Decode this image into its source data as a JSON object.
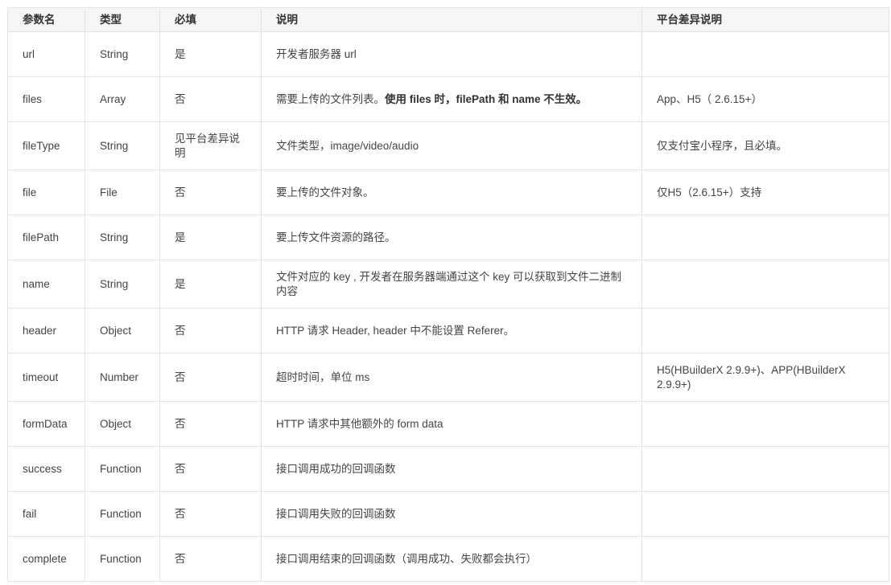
{
  "table": {
    "headers": [
      "参数名",
      "类型",
      "必填",
      "说明",
      "平台差异说明"
    ],
    "rows": [
      {
        "name": "url",
        "type": "String",
        "required": "是",
        "desc": "开发者服务器 url",
        "desc_bold": "",
        "platform": ""
      },
      {
        "name": "files",
        "type": "Array",
        "required": "否",
        "desc": "需要上传的文件列表。",
        "desc_bold": "使用 files 时，filePath 和 name 不生效。",
        "platform": "App、H5（ 2.6.15+）"
      },
      {
        "name": "fileType",
        "type": "String",
        "required": "见平台差异说明",
        "desc": "文件类型，image/video/audio",
        "desc_bold": "",
        "platform": "仅支付宝小程序，且必填。"
      },
      {
        "name": "file",
        "type": "File",
        "required": "否",
        "desc": "要上传的文件对象。",
        "desc_bold": "",
        "platform": "仅H5（2.6.15+）支持"
      },
      {
        "name": "filePath",
        "type": "String",
        "required": "是",
        "desc": "要上传文件资源的路径。",
        "desc_bold": "",
        "platform": ""
      },
      {
        "name": "name",
        "type": "String",
        "required": "是",
        "desc": "文件对应的 key , 开发者在服务器端通过这个 key 可以获取到文件二进制内容",
        "desc_bold": "",
        "platform": ""
      },
      {
        "name": "header",
        "type": "Object",
        "required": "否",
        "desc": "HTTP 请求 Header, header 中不能设置 Referer。",
        "desc_bold": "",
        "platform": ""
      },
      {
        "name": "timeout",
        "type": "Number",
        "required": "否",
        "desc": "超时时间，单位 ms",
        "desc_bold": "",
        "platform": "H5(HBuilderX 2.9.9+)、APP(HBuilderX 2.9.9+)"
      },
      {
        "name": "formData",
        "type": "Object",
        "required": "否",
        "desc": "HTTP 请求中其他额外的 form data",
        "desc_bold": "",
        "platform": ""
      },
      {
        "name": "success",
        "type": "Function",
        "required": "否",
        "desc": "接口调用成功的回调函数",
        "desc_bold": "",
        "platform": ""
      },
      {
        "name": "fail",
        "type": "Function",
        "required": "否",
        "desc": "接口调用失败的回调函数",
        "desc_bold": "",
        "platform": ""
      },
      {
        "name": "complete",
        "type": "Function",
        "required": "否",
        "desc": "接口调用结束的回调函数（调用成功、失败都会执行）",
        "desc_bold": "",
        "platform": ""
      }
    ]
  }
}
